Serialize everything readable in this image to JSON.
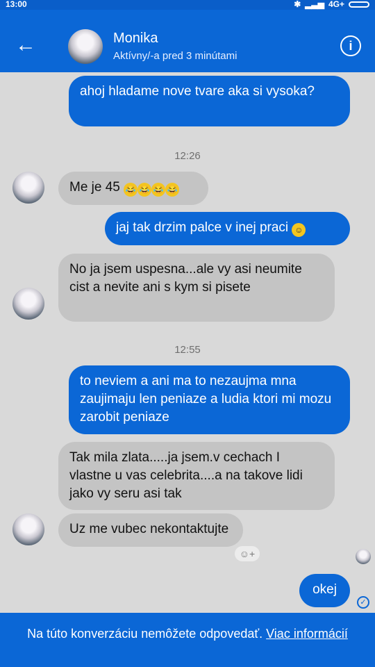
{
  "status_bar": {
    "time": "13:00",
    "network": "4G+"
  },
  "header": {
    "contact_name": "Monika",
    "status": "Aktívny/-a pred 3 minútami"
  },
  "messages": [
    {
      "text": "ahoj hladame nove tvare aka si vysoka?",
      "direction": "out"
    },
    {
      "time": "12:26"
    },
    {
      "text": "Me je 45",
      "direction": "in"
    },
    {
      "text": "jaj tak drzim palce v inej praci",
      "direction": "out"
    },
    {
      "text": "No ja jsem uspesna...ale vy asi neumite cist a nevite ani s kym si pisete",
      "direction": "in"
    },
    {
      "time": "12:55"
    },
    {
      "text": "to neviem a ani ma to nezaujma mna zaujimaju len peniaze a ludia ktori mi mozu zarobit peniaze",
      "direction": "out"
    },
    {
      "text": "Tak mila zlata.....ja jsem.v cechach I vlastne u vas celebrita....a na takove lidi jako vy seru asi tak",
      "direction": "in"
    },
    {
      "text": "Uz me vubec nekontaktujte",
      "direction": "in"
    },
    {
      "text": "okej",
      "direction": "out"
    }
  ],
  "footer": {
    "text": "Na túto konverzáciu nemôžete odpovedať.",
    "link": "Viac informácií"
  },
  "colors": {
    "header_bg": "#0b67d6",
    "outgoing_bubble": "#0b67d6",
    "incoming_bubble": "#c4c4c4",
    "background": "#d9d9d9"
  },
  "icons": [
    "back-arrow-icon",
    "info-icon",
    "smiley-icon",
    "add-reaction-icon",
    "seen-check-icon",
    "bluetooth-icon",
    "signal-icon",
    "battery-icon"
  ]
}
